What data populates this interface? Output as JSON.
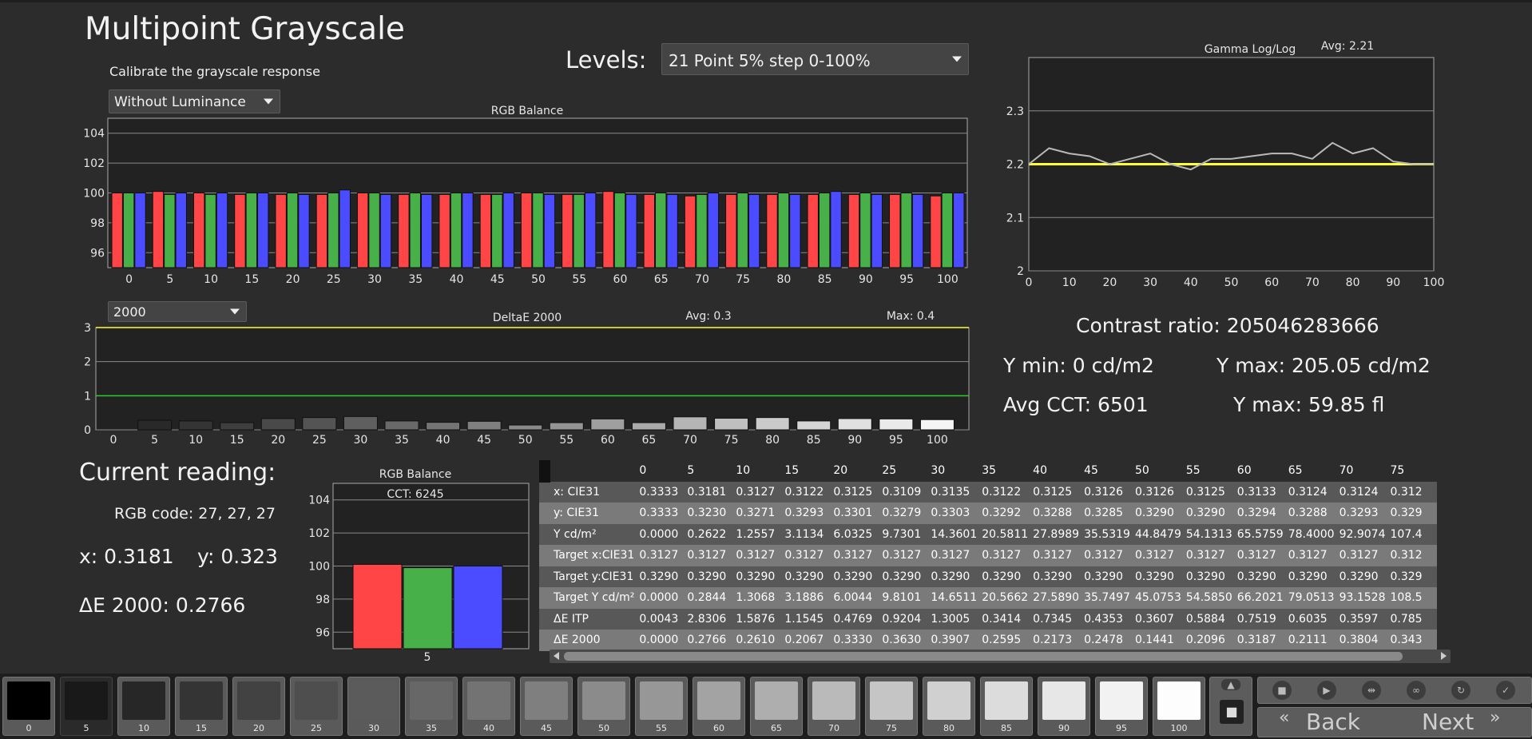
{
  "title": "Multipoint Grayscale",
  "subtitle": "Calibrate the grayscale response",
  "luminance_mode": "Without Luminance",
  "levels_label": "Levels:",
  "levels_value": "21 Point 5% step 0-100%",
  "deltae_mode": "2000",
  "colors": {
    "red": "#ff4545",
    "green": "#48b048",
    "blue": "#4b4bff",
    "target_line": "#ffff33",
    "gamma_line": "#b9b9b9",
    "de_one_line": "#2ecc2e"
  },
  "rgb_balance": {
    "title": "RGB Balance",
    "y_ticks": [
      "104",
      "102",
      "100",
      "98",
      "96"
    ],
    "x_ticks": [
      "0",
      "5",
      "10",
      "15",
      "20",
      "25",
      "30",
      "35",
      "40",
      "45",
      "50",
      "55",
      "60",
      "65",
      "70",
      "75",
      "80",
      "85",
      "90",
      "95",
      "100"
    ]
  },
  "deltae": {
    "title": "DeltaE 2000",
    "avg": "Avg: 0.3",
    "max": "Max: 0.4",
    "y_ticks": [
      "3",
      "2",
      "1",
      "0"
    ],
    "x_ticks": [
      "0",
      "5",
      "10",
      "15",
      "20",
      "25",
      "30",
      "35",
      "40",
      "45",
      "50",
      "55",
      "60",
      "65",
      "70",
      "75",
      "80",
      "85",
      "90",
      "95",
      "100"
    ]
  },
  "gamma": {
    "title": "Gamma Log/Log",
    "avg": "Avg: 2.21",
    "y_ticks": [
      "2.3",
      "2.2",
      "2.1",
      "2"
    ],
    "x_ticks": [
      "0",
      "10",
      "20",
      "30",
      "40",
      "50",
      "60",
      "70",
      "80",
      "90",
      "100"
    ]
  },
  "stats": {
    "contrast": "Contrast ratio: 205046283666",
    "ymin": "Y min: 0 cd/m2",
    "ymax": "Y max: 205.05 cd/m2",
    "avg_cct": "Avg CCT: 6501",
    "ymax_fl": "Y max: 59.85 fl"
  },
  "current": {
    "title": "Current reading:",
    "rgb_code": "RGB code: 27, 27, 27",
    "x": "x: 0.3181",
    "y": "y: 0.323",
    "de": "ΔE 2000: 0.2766",
    "chart_title": "RGB Balance",
    "cct": "CCT: 6245",
    "y_ticks": [
      "104",
      "102",
      "100",
      "98",
      "96"
    ],
    "x_label": "5"
  },
  "table": {
    "columns": [
      "0",
      "5",
      "10",
      "15",
      "20",
      "25",
      "30",
      "35",
      "40",
      "45",
      "50",
      "55",
      "60",
      "65",
      "70",
      "75"
    ],
    "rows": [
      {
        "label": "x: CIE31",
        "values": [
          "0.3333",
          "0.3181",
          "0.3127",
          "0.3122",
          "0.3125",
          "0.3109",
          "0.3135",
          "0.3122",
          "0.3125",
          "0.3126",
          "0.3126",
          "0.3125",
          "0.3133",
          "0.3124",
          "0.3124",
          "0.312"
        ]
      },
      {
        "label": "y: CIE31",
        "values": [
          "0.3333",
          "0.3230",
          "0.3271",
          "0.3293",
          "0.3301",
          "0.3279",
          "0.3303",
          "0.3292",
          "0.3288",
          "0.3285",
          "0.3290",
          "0.3290",
          "0.3294",
          "0.3288",
          "0.3293",
          "0.329"
        ]
      },
      {
        "label": "Y cd/m²",
        "values": [
          "0.0000",
          "0.2622",
          "1.2557",
          "3.1134",
          "6.0325",
          "9.7301",
          "14.3601",
          "20.5811",
          "27.8989",
          "35.5319",
          "44.8479",
          "54.1313",
          "65.5759",
          "78.4000",
          "92.9074",
          "107.4"
        ]
      },
      {
        "label": "Target x:CIE31",
        "values": [
          "0.3127",
          "0.3127",
          "0.3127",
          "0.3127",
          "0.3127",
          "0.3127",
          "0.3127",
          "0.3127",
          "0.3127",
          "0.3127",
          "0.3127",
          "0.3127",
          "0.3127",
          "0.3127",
          "0.3127",
          "0.312"
        ]
      },
      {
        "label": "Target y:CIE31",
        "values": [
          "0.3290",
          "0.3290",
          "0.3290",
          "0.3290",
          "0.3290",
          "0.3290",
          "0.3290",
          "0.3290",
          "0.3290",
          "0.3290",
          "0.3290",
          "0.3290",
          "0.3290",
          "0.3290",
          "0.3290",
          "0.329"
        ]
      },
      {
        "label": "Target Y cd/m²",
        "values": [
          "0.0000",
          "0.2844",
          "1.3068",
          "3.1886",
          "6.0044",
          "9.8101",
          "14.6511",
          "20.5662",
          "27.5890",
          "35.7497",
          "45.0753",
          "54.5850",
          "66.2021",
          "79.0513",
          "93.1528",
          "108.5"
        ]
      },
      {
        "label": "ΔE ITP",
        "values": [
          "0.0043",
          "2.8306",
          "1.5876",
          "1.1545",
          "0.4769",
          "0.9204",
          "1.3005",
          "0.3414",
          "0.7345",
          "0.4353",
          "0.3607",
          "0.5884",
          "0.7519",
          "0.6035",
          "0.3597",
          "0.785"
        ]
      },
      {
        "label": "ΔE 2000",
        "values": [
          "0.0000",
          "0.2766",
          "0.2610",
          "0.2067",
          "0.3330",
          "0.3630",
          "0.3907",
          "0.2595",
          "0.2173",
          "0.2478",
          "0.1441",
          "0.2096",
          "0.3187",
          "0.2111",
          "0.3804",
          "0.343"
        ]
      }
    ]
  },
  "patches": [
    "0",
    "5",
    "10",
    "15",
    "20",
    "25",
    "30",
    "35",
    "40",
    "45",
    "50",
    "55",
    "60",
    "65",
    "70",
    "75",
    "80",
    "85",
    "90",
    "95",
    "100"
  ],
  "selected_patch": "5",
  "nav": {
    "back": "Back",
    "next": "Next"
  },
  "chart_data": [
    {
      "type": "bar",
      "title": "RGB Balance",
      "categories": [
        "0",
        "5",
        "10",
        "15",
        "20",
        "25",
        "30",
        "35",
        "40",
        "45",
        "50",
        "55",
        "60",
        "65",
        "70",
        "75",
        "80",
        "85",
        "90",
        "95",
        "100"
      ],
      "ylim": [
        95,
        105
      ],
      "series": [
        {
          "name": "R",
          "values": [
            100.0,
            100.1,
            100.0,
            99.9,
            99.9,
            99.9,
            100.0,
            99.9,
            99.9,
            99.9,
            100.0,
            99.9,
            100.1,
            99.9,
            99.8,
            99.9,
            99.9,
            99.9,
            99.9,
            99.9,
            99.8
          ]
        },
        {
          "name": "G",
          "values": [
            100.0,
            99.9,
            99.9,
            100.0,
            100.0,
            100.0,
            100.0,
            100.0,
            100.0,
            99.9,
            100.0,
            99.9,
            100.0,
            100.0,
            99.9,
            100.0,
            100.0,
            100.0,
            100.0,
            100.0,
            100.0
          ]
        },
        {
          "name": "B",
          "values": [
            100.0,
            100.0,
            100.0,
            100.0,
            99.9,
            100.2,
            99.9,
            99.9,
            100.0,
            100.0,
            99.9,
            100.0,
            99.9,
            99.9,
            100.0,
            99.9,
            99.9,
            100.1,
            99.9,
            99.9,
            100.0
          ]
        }
      ]
    },
    {
      "type": "bar",
      "title": "DeltaE 2000",
      "categories": [
        "0",
        "5",
        "10",
        "15",
        "20",
        "25",
        "30",
        "35",
        "40",
        "45",
        "50",
        "55",
        "60",
        "65",
        "70",
        "75",
        "80",
        "85",
        "90",
        "95",
        "100"
      ],
      "ylim": [
        0,
        3
      ],
      "values": [
        0.0,
        0.28,
        0.26,
        0.21,
        0.33,
        0.36,
        0.39,
        0.26,
        0.22,
        0.25,
        0.14,
        0.21,
        0.32,
        0.21,
        0.38,
        0.34,
        0.36,
        0.26,
        0.33,
        0.32,
        0.3
      ]
    },
    {
      "type": "line",
      "title": "Gamma Log/Log",
      "x": [
        0,
        5,
        10,
        15,
        20,
        25,
        30,
        35,
        40,
        45,
        50,
        55,
        60,
        65,
        70,
        75,
        80,
        85,
        90,
        95,
        100
      ],
      "ylim": [
        2.0,
        2.4
      ],
      "xlim": [
        0,
        100
      ],
      "series": [
        {
          "values": [
            2.2,
            2.23,
            2.22,
            2.215,
            2.2,
            2.21,
            2.22,
            2.2,
            2.19,
            2.21,
            2.21,
            2.215,
            2.22,
            2.22,
            2.21,
            2.24,
            2.22,
            2.23,
            2.205,
            2.2,
            2.2
          ]
        },
        {
          "values": [
            2.2,
            2.2,
            2.2,
            2.2,
            2.2,
            2.2,
            2.2,
            2.2,
            2.2,
            2.2,
            2.2,
            2.2,
            2.2,
            2.2,
            2.2,
            2.2,
            2.2,
            2.2,
            2.2,
            2.2,
            2.2
          ]
        }
      ]
    },
    {
      "type": "bar",
      "title": "RGB Balance",
      "categories": [
        "5"
      ],
      "ylim": [
        95,
        105
      ],
      "series": [
        {
          "name": "R",
          "values": [
            100.1
          ]
        },
        {
          "name": "G",
          "values": [
            99.9
          ]
        },
        {
          "name": "B",
          "values": [
            100.0
          ]
        }
      ]
    }
  ]
}
